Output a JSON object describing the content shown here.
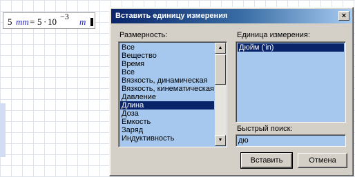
{
  "worksheet": {
    "formula": {
      "number": "5",
      "unit_left": "mm",
      "equals": "=",
      "mantissa": "5",
      "operator": "·",
      "base": "10",
      "exponent": "−3",
      "unit_right": "m"
    }
  },
  "dialog": {
    "title": "Вставить единицу измерения",
    "close_label": "×",
    "dimension_label": "Размерность:",
    "dimension_items": [
      "Все",
      "Вещество",
      "Время",
      "Все",
      "Вязкость, динамическая",
      "Вязкость, кинематическая",
      "Давление",
      "Длина",
      "Доза",
      "Емкость",
      "Заряд",
      "Индуктивность"
    ],
    "dimension_selected": "Длина",
    "unit_label": "Единица измерения:",
    "unit_items": [
      "Дюйм ('in)"
    ],
    "unit_selected": "Дюйм ('in)",
    "search_label": "Быстрый поиск:",
    "search_value": "дю",
    "insert_label": "Вставить",
    "cancel_label": "Отмена",
    "scroll_up_glyph": "▲",
    "scroll_down_glyph": "▼"
  },
  "colors": {
    "titlebar": "#0a246a",
    "list_background": "#a6c8ef",
    "selection": "#0a246a",
    "dialog_face": "#d4d0c8",
    "unit_text": "#1c1cc8"
  },
  "icons": {
    "close": "close-icon",
    "scroll_up": "arrow-up-icon",
    "scroll_down": "arrow-down-icon"
  }
}
